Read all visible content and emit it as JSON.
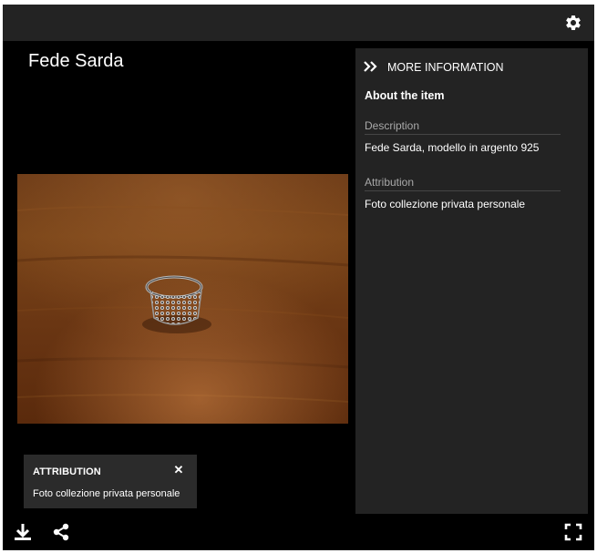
{
  "title": "Fede Sarda",
  "attribution_popup": {
    "heading": "ATTRIBUTION",
    "close_glyph": "✕",
    "text": "Foto collezione privata personale"
  },
  "info_panel": {
    "toggle_label": "MORE INFORMATION",
    "about_heading": "About the item",
    "sections": [
      {
        "label": "Description",
        "value": "Fede Sarda, modello in argento 925"
      },
      {
        "label": "Attribution",
        "value": "Foto collezione privata personale"
      }
    ]
  },
  "icons": {
    "settings": "gear-icon",
    "more_info": "double-chevron-right-icon",
    "download": "download-icon",
    "share": "share-icon",
    "fullscreen": "fullscreen-icon",
    "close": "close-icon"
  },
  "colors": {
    "viewer_bg": "#000000",
    "bar_bg": "#232323",
    "panel_bg": "#232323",
    "popup_bg": "#2b2b2b",
    "text": "#ffffff",
    "muted_text": "#a9a9a9"
  }
}
